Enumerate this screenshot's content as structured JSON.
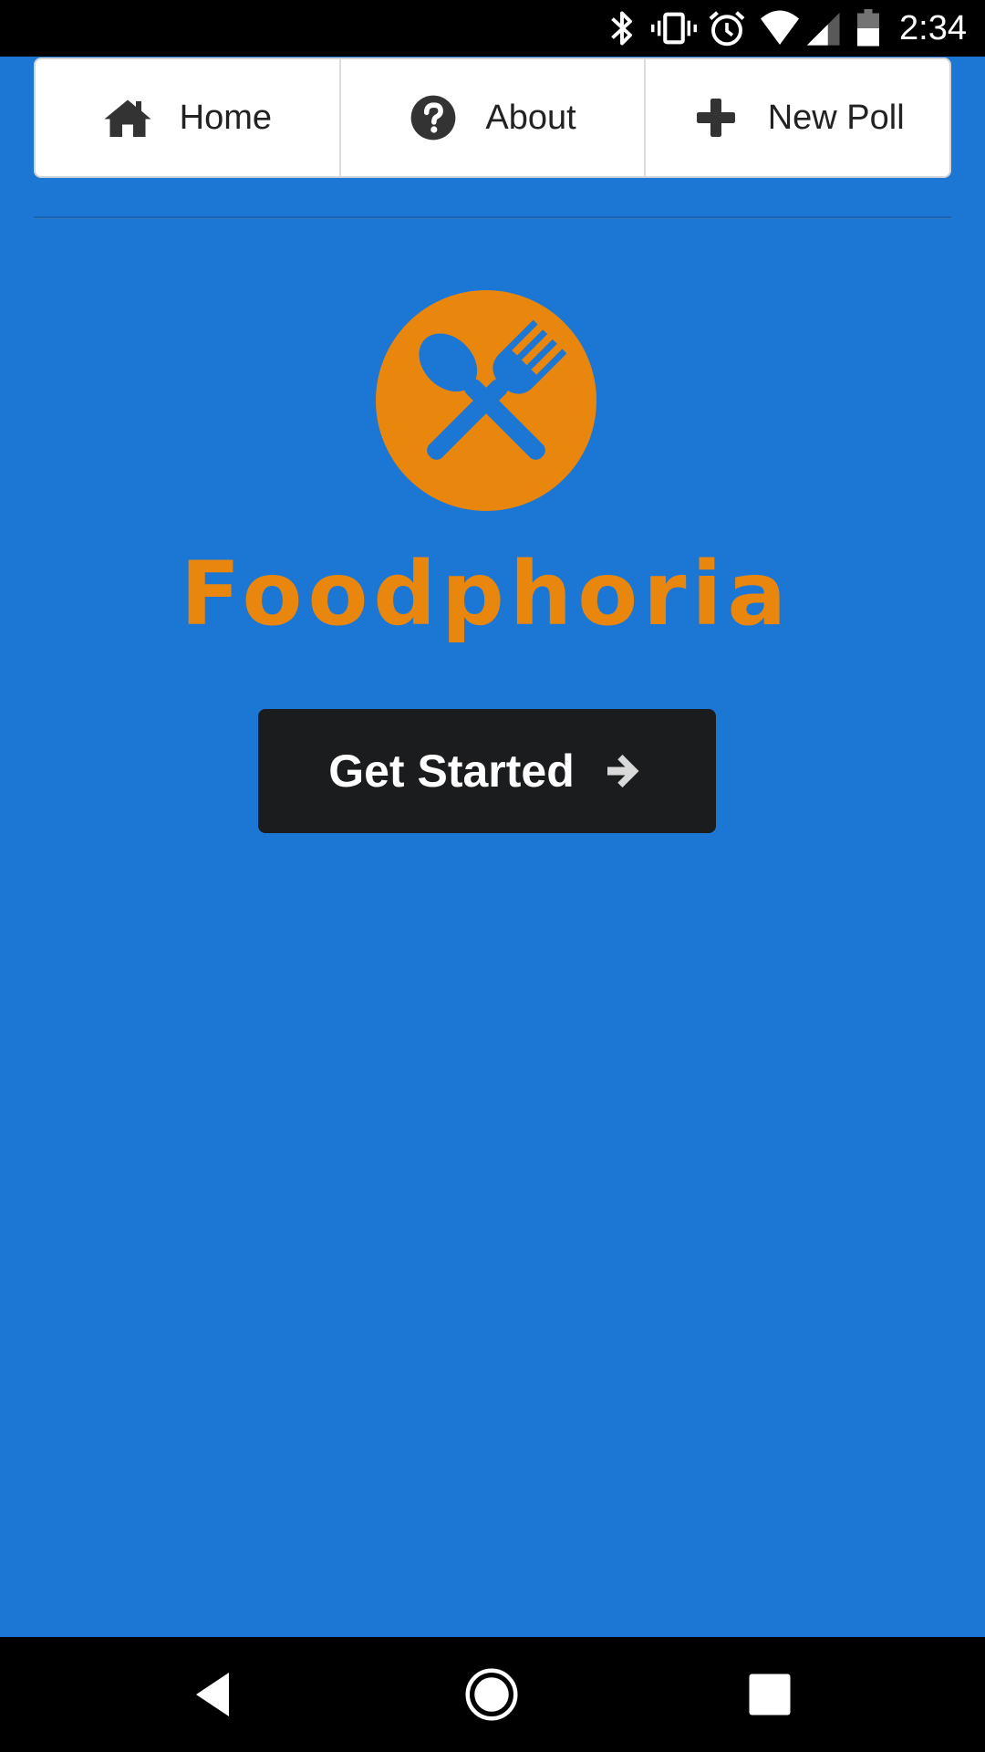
{
  "status_bar": {
    "time": "2:34",
    "icons": [
      "bluetooth-icon",
      "vibrate-icon",
      "alarm-icon",
      "wifi-icon",
      "signal-icon",
      "battery-icon"
    ]
  },
  "menu": {
    "items": [
      {
        "label": "Home",
        "icon": "home-icon"
      },
      {
        "label": "About",
        "icon": "question-circle-icon"
      },
      {
        "label": "New Poll",
        "icon": "plus-icon"
      }
    ]
  },
  "brand": {
    "name": "Foodphoria",
    "logo_icon": "spoon-fork-icon"
  },
  "cta": {
    "label": "Get Started",
    "icon": "arrow-right-icon"
  },
  "nav": {
    "icons": [
      "back-icon",
      "home-circle-icon",
      "recents-icon"
    ]
  },
  "colors": {
    "background": "#1b77d3",
    "accent": "#e8860e",
    "button": "#1b1c1d"
  }
}
